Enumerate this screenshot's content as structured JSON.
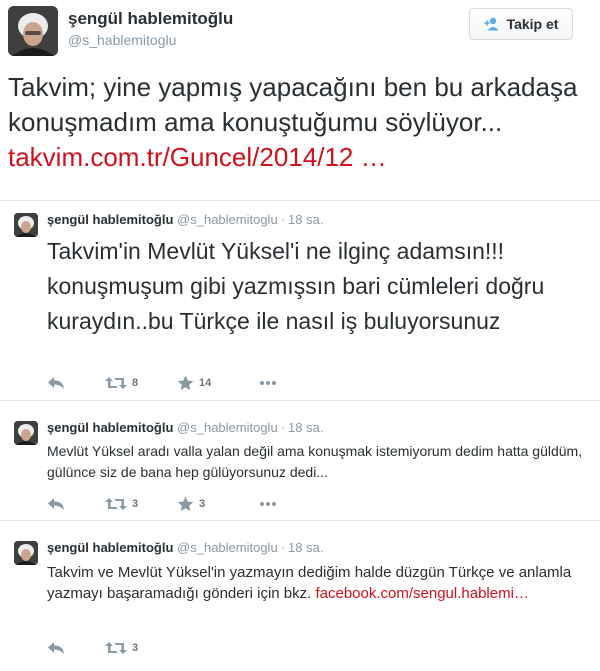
{
  "main_tweet": {
    "name": "şengül hablemitoğlu",
    "handle": "@s_hablemitoglu",
    "follow_label": "Takip et",
    "text": "Takvim; yine yapmış yapacağını ben bu arkadaşa konuşmadım ama konuştuğumu söylüyor... ",
    "link": "takvim.com.tr/Guncel/2014/12 …"
  },
  "replies": [
    {
      "name": "şengül hablemitoğlu",
      "handle": "@s_hablemitoglu",
      "time": "18 sa.",
      "text": "Takvim'in Mevlüt Yüksel'i ne ilginç adamsın!!! konuşmuşum gibi yazmışsın bari cümleleri doğru kuraydın..bu Türkçe ile nasıl iş buluyorsunuz",
      "retweets": "8",
      "favorites": "14"
    },
    {
      "name": "şengül hablemitoğlu",
      "handle": "@s_hablemitoglu",
      "time": "18 sa.",
      "text": "Mevlüt Yüksel aradı valla yalan değil ama konuşmak istemiyorum dedim hatta güldüm, gülünce siz de bana hep gülüyorsunuz dedi...",
      "retweets": "3",
      "favorites": "3"
    },
    {
      "name": "şengül hablemitoğlu",
      "handle": "@s_hablemitoglu",
      "time": "18 sa.",
      "text": "Takvim ve Mevlüt Yüksel'in yazmayın dediğim halde düzgün Türkçe ve anlamla yazmayı başaramadığı gönderi için bkz. ",
      "link": "facebook.com/sengul.hablemi…",
      "retweets": "3"
    }
  ],
  "colors": {
    "link": "#d0111b",
    "text": "#292f33",
    "muted": "#8899a6",
    "icon": "#8899a6",
    "follow_icon": "#55acee"
  },
  "icons": {
    "follow": "person-add-icon",
    "reply": "reply-arrow-icon",
    "retweet": "retweet-icon",
    "favorite": "star-icon",
    "more": "more-dots-icon"
  }
}
